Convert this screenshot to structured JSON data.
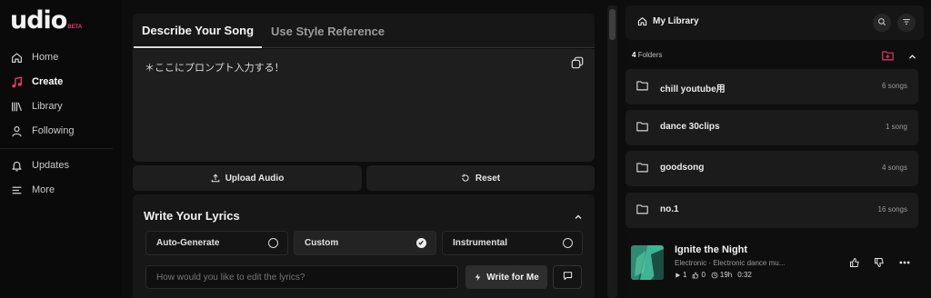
{
  "brand": {
    "name": "udio",
    "badge": "BETA",
    "accent": "#e63b68"
  },
  "sidebar": {
    "items": [
      {
        "label": "Home",
        "icon": "home-icon"
      },
      {
        "label": "Create",
        "icon": "music-note-icon",
        "active": true
      },
      {
        "label": "Library",
        "icon": "library-icon"
      },
      {
        "label": "Following",
        "icon": "person-icon"
      },
      {
        "label": "Updates",
        "icon": "bell-icon"
      },
      {
        "label": "More",
        "icon": "menu-icon"
      }
    ]
  },
  "create": {
    "tabs": [
      {
        "label": "Describe Your Song",
        "active": true
      },
      {
        "label": "Use Style Reference",
        "active": false
      }
    ],
    "prompt_text": "＊ここにプロンプト入力する！",
    "upload_label": "Upload Audio",
    "reset_label": "Reset"
  },
  "lyrics": {
    "title": "Write Your Lyrics",
    "options": [
      {
        "label": "Auto-Generate",
        "selected": false
      },
      {
        "label": "Custom",
        "selected": true
      },
      {
        "label": "Instrumental",
        "selected": false
      }
    ],
    "input_placeholder": "How would you like to edit the lyrics?",
    "write_label": "Write for Me"
  },
  "library": {
    "title": "My Library",
    "folders_count": "4",
    "folders_label": "Folders",
    "folders": [
      {
        "name": "chill youtube用",
        "count": "6 songs"
      },
      {
        "name": "dance 30clips",
        "count": "1 song"
      },
      {
        "name": "goodsong",
        "count": "4 songs"
      },
      {
        "name": "no.1",
        "count": "16 songs"
      }
    ],
    "song": {
      "title": "Ignite the Night",
      "genre": "Electronic   ·   Electronic dance mu...",
      "plays": "1",
      "likes": "0",
      "age": "19h",
      "duration": "0:32"
    }
  }
}
